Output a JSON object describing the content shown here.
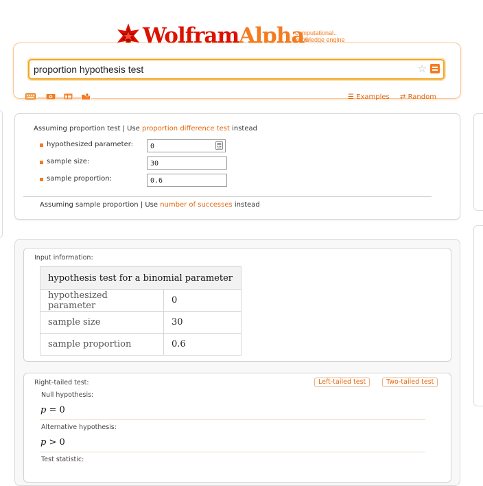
{
  "header": {
    "brand_wolfram": "Wolfram",
    "brand_alpha": "Alpha",
    "registered_mark": "®",
    "tagline_line1": "computational..",
    "tagline_line2": "knowledge engine",
    "search_value": "proportion hypothesis test",
    "star_glyph": "☆",
    "examples_label": "Examples",
    "random_label": "Random",
    "examples_icon": "list-icon",
    "random_icon": "shuffle-icon",
    "accent_color": "#f47b20",
    "brand_red": "#dd1100"
  },
  "assumptions": {
    "line1_prefix": "Assuming proportion test | Use ",
    "line1_link": "proportion difference test",
    "line1_suffix": " instead",
    "params": [
      {
        "label": "hypothesized parameter:",
        "value": "0"
      },
      {
        "label": "sample size:",
        "value": "30"
      },
      {
        "label": "sample proportion:",
        "value": "0.6"
      }
    ],
    "line2_prefix": "Assuming sample proportion  | Use ",
    "line2_link": "number of successes",
    "line2_suffix": " instead"
  },
  "input_pod": {
    "title": "Input information:",
    "table_header": "hypothesis test for a binomial parameter",
    "rows": [
      {
        "label": "hypothesized parameter",
        "value": "0"
      },
      {
        "label": "sample size",
        "value": "30"
      },
      {
        "label": "sample proportion",
        "value": "0.6"
      }
    ]
  },
  "test_pod": {
    "title": "Right-tailed test:",
    "left_button": "Left-tailed test",
    "two_button": "Two-tailed test",
    "null_label": "Null hypothesis:",
    "null_var": "p",
    "null_rel": " = 0",
    "alt_label": "Alternative hypothesis:",
    "alt_var": "p",
    "alt_rel": " > 0",
    "stat_label": "Test statistic:"
  }
}
